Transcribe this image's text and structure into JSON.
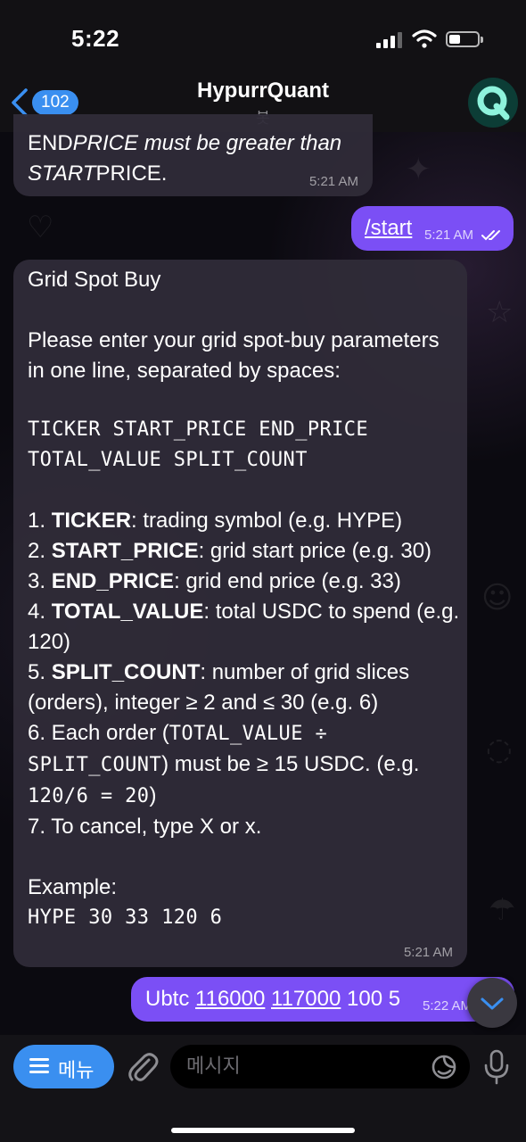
{
  "status_bar": {
    "time": "5:22"
  },
  "header": {
    "back_count": "102",
    "title": "HypurrQuant",
    "subtitle": "봇",
    "avatar_letter": "Q"
  },
  "messages": {
    "prev": {
      "line1_a": "END",
      "line1_b": "PRICE must be greater than",
      "line2_a": "START",
      "line2_b": "PRICE.",
      "time": "5:21 AM"
    },
    "cmd": {
      "text": "/start",
      "time": "5:21 AM"
    },
    "grid": {
      "title": "Grid Spot Buy",
      "intro": "Please enter your grid spot-buy parameters in one line, separated by spaces:",
      "format_line1": "TICKER START_PRICE END_PRICE",
      "format_line2": "TOTAL_VALUE SPLIT_COUNT",
      "items": [
        {
          "num": "1.",
          "key": "TICKER",
          "desc": ": trading symbol (e.g. HYPE)"
        },
        {
          "num": "2.",
          "key": "START_PRICE",
          "desc": ": grid start price (e.g. 30)"
        },
        {
          "num": "3.",
          "key": "END_PRICE",
          "desc": ": grid end price (e.g. 33)"
        },
        {
          "num": "4.",
          "key": "TOTAL_VALUE",
          "desc": ": total USDC to spend (e.g. 120)"
        },
        {
          "num": "5.",
          "key": "SPLIT_COUNT",
          "desc": ": number of grid slices (orders), integer ≥ 2 and ≤ 30 (e.g. 6)"
        }
      ],
      "item6_a": "6. Each order (",
      "item6_mono1": "TOTAL_VALUE ÷ SPLIT_COUNT",
      "item6_b": ") must be ≥ 15 USDC. (e.g.",
      "item6_mono2": "120/6 = 20",
      "item6_c": ")",
      "item7": "7. To cancel, type X or x.",
      "example_label": "Example:",
      "example": "HYPE 30 33 120 6",
      "time": "5:21 AM"
    },
    "user": {
      "ticker": "Ubtc",
      "start": "116000",
      "end": "117000",
      "rest": "100 5",
      "time": "5:22 AM"
    }
  },
  "input_bar": {
    "menu_label": "메뉴",
    "placeholder": "메시지"
  },
  "colors": {
    "accent_blue": "#3a8ff0",
    "outgoing_bubble": "#7b4ff5",
    "incoming_bubble": "#302c38"
  }
}
